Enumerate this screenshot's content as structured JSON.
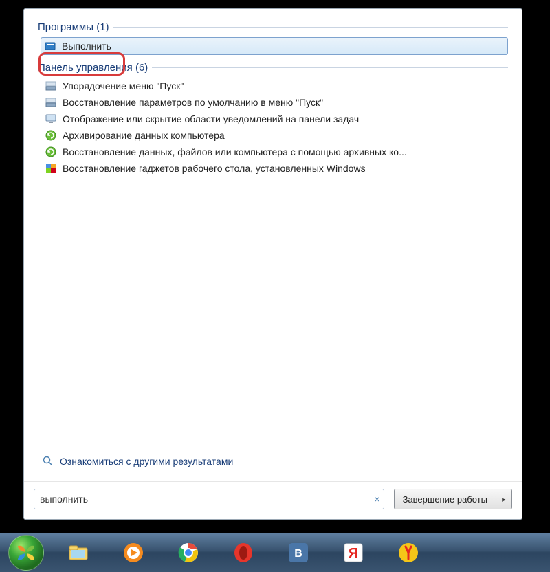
{
  "groups": {
    "programs": {
      "header": "Программы (1)",
      "items": [
        {
          "label": "Выполнить",
          "icon": "run-icon",
          "selected": true
        }
      ]
    },
    "control_panel": {
      "header": "Панель управления (6)",
      "items": [
        {
          "label": "Упорядочение меню \"Пуск\"",
          "icon": "taskbar-icon"
        },
        {
          "label": "Восстановление параметров по умолчанию в меню \"Пуск\"",
          "icon": "taskbar-icon"
        },
        {
          "label": "Отображение или скрытие области уведомлений на панели задач",
          "icon": "monitor-icon"
        },
        {
          "label": "Архивирование данных компьютера",
          "icon": "backup-icon"
        },
        {
          "label": "Восстановление данных, файлов или компьютера с помощью архивных ко...",
          "icon": "backup-icon"
        },
        {
          "label": "Восстановление гаджетов рабочего стола, установленных Windows",
          "icon": "gadget-icon"
        }
      ]
    }
  },
  "see_more": "Ознакомиться с другими результатами",
  "search": {
    "value": "выполнить",
    "clear_glyph": "×"
  },
  "shutdown": {
    "label": "Завершение работы",
    "arrow": "▸"
  },
  "taskbar": {
    "items": [
      {
        "name": "start-button",
        "icon": "start"
      },
      {
        "name": "explorer",
        "icon": "explorer"
      },
      {
        "name": "wmp",
        "icon": "wmp"
      },
      {
        "name": "chrome",
        "icon": "chrome"
      },
      {
        "name": "opera",
        "icon": "opera"
      },
      {
        "name": "vk",
        "icon": "vk"
      },
      {
        "name": "yandex-search",
        "icon": "ya-red"
      },
      {
        "name": "yandex-browser",
        "icon": "ya-yellow"
      }
    ]
  }
}
